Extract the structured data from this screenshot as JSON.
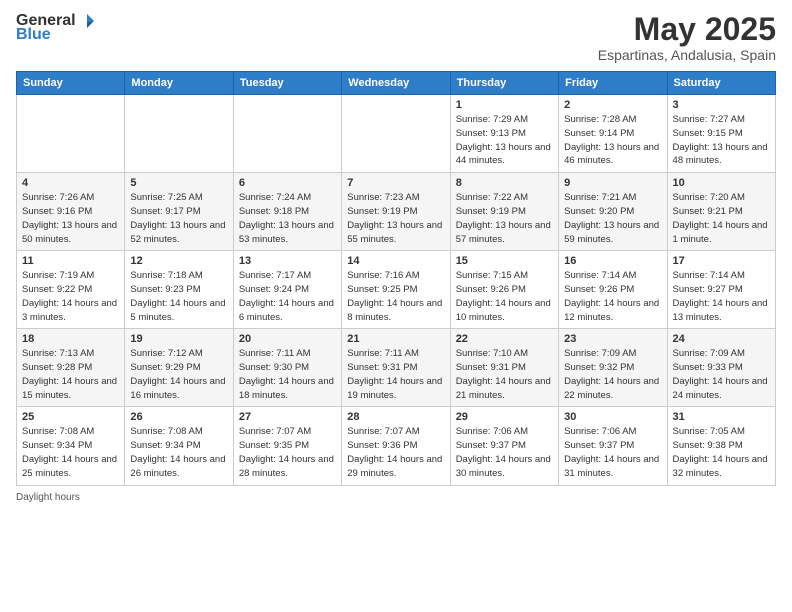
{
  "header": {
    "logo_general": "General",
    "logo_blue": "Blue",
    "title": "May 2025",
    "subtitle": "Espartinas, Andalusia, Spain"
  },
  "weekdays": [
    "Sunday",
    "Monday",
    "Tuesday",
    "Wednesday",
    "Thursday",
    "Friday",
    "Saturday"
  ],
  "weeks": [
    [
      {
        "day": "",
        "sunrise": "",
        "sunset": "",
        "daylight": ""
      },
      {
        "day": "",
        "sunrise": "",
        "sunset": "",
        "daylight": ""
      },
      {
        "day": "",
        "sunrise": "",
        "sunset": "",
        "daylight": ""
      },
      {
        "day": "",
        "sunrise": "",
        "sunset": "",
        "daylight": ""
      },
      {
        "day": "1",
        "sunrise": "Sunrise: 7:29 AM",
        "sunset": "Sunset: 9:13 PM",
        "daylight": "Daylight: 13 hours and 44 minutes."
      },
      {
        "day": "2",
        "sunrise": "Sunrise: 7:28 AM",
        "sunset": "Sunset: 9:14 PM",
        "daylight": "Daylight: 13 hours and 46 minutes."
      },
      {
        "day": "3",
        "sunrise": "Sunrise: 7:27 AM",
        "sunset": "Sunset: 9:15 PM",
        "daylight": "Daylight: 13 hours and 48 minutes."
      }
    ],
    [
      {
        "day": "4",
        "sunrise": "Sunrise: 7:26 AM",
        "sunset": "Sunset: 9:16 PM",
        "daylight": "Daylight: 13 hours and 50 minutes."
      },
      {
        "day": "5",
        "sunrise": "Sunrise: 7:25 AM",
        "sunset": "Sunset: 9:17 PM",
        "daylight": "Daylight: 13 hours and 52 minutes."
      },
      {
        "day": "6",
        "sunrise": "Sunrise: 7:24 AM",
        "sunset": "Sunset: 9:18 PM",
        "daylight": "Daylight: 13 hours and 53 minutes."
      },
      {
        "day": "7",
        "sunrise": "Sunrise: 7:23 AM",
        "sunset": "Sunset: 9:19 PM",
        "daylight": "Daylight: 13 hours and 55 minutes."
      },
      {
        "day": "8",
        "sunrise": "Sunrise: 7:22 AM",
        "sunset": "Sunset: 9:19 PM",
        "daylight": "Daylight: 13 hours and 57 minutes."
      },
      {
        "day": "9",
        "sunrise": "Sunrise: 7:21 AM",
        "sunset": "Sunset: 9:20 PM",
        "daylight": "Daylight: 13 hours and 59 minutes."
      },
      {
        "day": "10",
        "sunrise": "Sunrise: 7:20 AM",
        "sunset": "Sunset: 9:21 PM",
        "daylight": "Daylight: 14 hours and 1 minute."
      }
    ],
    [
      {
        "day": "11",
        "sunrise": "Sunrise: 7:19 AM",
        "sunset": "Sunset: 9:22 PM",
        "daylight": "Daylight: 14 hours and 3 minutes."
      },
      {
        "day": "12",
        "sunrise": "Sunrise: 7:18 AM",
        "sunset": "Sunset: 9:23 PM",
        "daylight": "Daylight: 14 hours and 5 minutes."
      },
      {
        "day": "13",
        "sunrise": "Sunrise: 7:17 AM",
        "sunset": "Sunset: 9:24 PM",
        "daylight": "Daylight: 14 hours and 6 minutes."
      },
      {
        "day": "14",
        "sunrise": "Sunrise: 7:16 AM",
        "sunset": "Sunset: 9:25 PM",
        "daylight": "Daylight: 14 hours and 8 minutes."
      },
      {
        "day": "15",
        "sunrise": "Sunrise: 7:15 AM",
        "sunset": "Sunset: 9:26 PM",
        "daylight": "Daylight: 14 hours and 10 minutes."
      },
      {
        "day": "16",
        "sunrise": "Sunrise: 7:14 AM",
        "sunset": "Sunset: 9:26 PM",
        "daylight": "Daylight: 14 hours and 12 minutes."
      },
      {
        "day": "17",
        "sunrise": "Sunrise: 7:14 AM",
        "sunset": "Sunset: 9:27 PM",
        "daylight": "Daylight: 14 hours and 13 minutes."
      }
    ],
    [
      {
        "day": "18",
        "sunrise": "Sunrise: 7:13 AM",
        "sunset": "Sunset: 9:28 PM",
        "daylight": "Daylight: 14 hours and 15 minutes."
      },
      {
        "day": "19",
        "sunrise": "Sunrise: 7:12 AM",
        "sunset": "Sunset: 9:29 PM",
        "daylight": "Daylight: 14 hours and 16 minutes."
      },
      {
        "day": "20",
        "sunrise": "Sunrise: 7:11 AM",
        "sunset": "Sunset: 9:30 PM",
        "daylight": "Daylight: 14 hours and 18 minutes."
      },
      {
        "day": "21",
        "sunrise": "Sunrise: 7:11 AM",
        "sunset": "Sunset: 9:31 PM",
        "daylight": "Daylight: 14 hours and 19 minutes."
      },
      {
        "day": "22",
        "sunrise": "Sunrise: 7:10 AM",
        "sunset": "Sunset: 9:31 PM",
        "daylight": "Daylight: 14 hours and 21 minutes."
      },
      {
        "day": "23",
        "sunrise": "Sunrise: 7:09 AM",
        "sunset": "Sunset: 9:32 PM",
        "daylight": "Daylight: 14 hours and 22 minutes."
      },
      {
        "day": "24",
        "sunrise": "Sunrise: 7:09 AM",
        "sunset": "Sunset: 9:33 PM",
        "daylight": "Daylight: 14 hours and 24 minutes."
      }
    ],
    [
      {
        "day": "25",
        "sunrise": "Sunrise: 7:08 AM",
        "sunset": "Sunset: 9:34 PM",
        "daylight": "Daylight: 14 hours and 25 minutes."
      },
      {
        "day": "26",
        "sunrise": "Sunrise: 7:08 AM",
        "sunset": "Sunset: 9:34 PM",
        "daylight": "Daylight: 14 hours and 26 minutes."
      },
      {
        "day": "27",
        "sunrise": "Sunrise: 7:07 AM",
        "sunset": "Sunset: 9:35 PM",
        "daylight": "Daylight: 14 hours and 28 minutes."
      },
      {
        "day": "28",
        "sunrise": "Sunrise: 7:07 AM",
        "sunset": "Sunset: 9:36 PM",
        "daylight": "Daylight: 14 hours and 29 minutes."
      },
      {
        "day": "29",
        "sunrise": "Sunrise: 7:06 AM",
        "sunset": "Sunset: 9:37 PM",
        "daylight": "Daylight: 14 hours and 30 minutes."
      },
      {
        "day": "30",
        "sunrise": "Sunrise: 7:06 AM",
        "sunset": "Sunset: 9:37 PM",
        "daylight": "Daylight: 14 hours and 31 minutes."
      },
      {
        "day": "31",
        "sunrise": "Sunrise: 7:05 AM",
        "sunset": "Sunset: 9:38 PM",
        "daylight": "Daylight: 14 hours and 32 minutes."
      }
    ]
  ],
  "footer": {
    "daylight_label": "Daylight hours"
  }
}
